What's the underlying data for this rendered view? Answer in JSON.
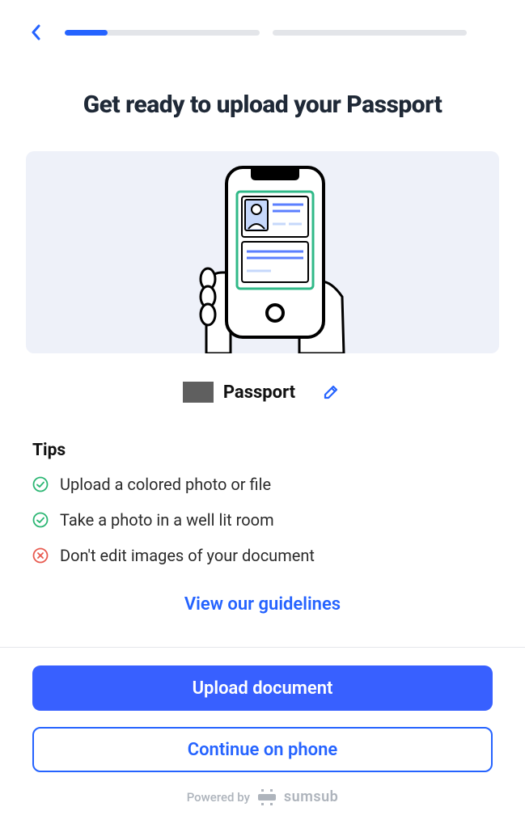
{
  "progress": {
    "segments": 2,
    "fill_pct_segment1": 22,
    "fill_pct_segment2": 0
  },
  "title": "Get ready to upload your Passport",
  "doc": {
    "label": "Passport"
  },
  "tips": {
    "heading": "Tips",
    "items": [
      {
        "text": "Upload a colored photo or file",
        "ok": true
      },
      {
        "text": "Take a photo in a well lit room",
        "ok": true
      },
      {
        "text": "Don't edit images of your document",
        "ok": false
      }
    ]
  },
  "links": {
    "guidelines": "View our guidelines"
  },
  "buttons": {
    "upload": "Upload document",
    "continue_phone": "Continue on phone"
  },
  "footer": {
    "powered_by": "Powered by",
    "brand": "sumsub"
  },
  "colors": {
    "primary": "#3860ff",
    "link": "#2563ff",
    "success": "#2bb673",
    "error": "#e85a4f",
    "illus_bg": "#eef1f9"
  }
}
